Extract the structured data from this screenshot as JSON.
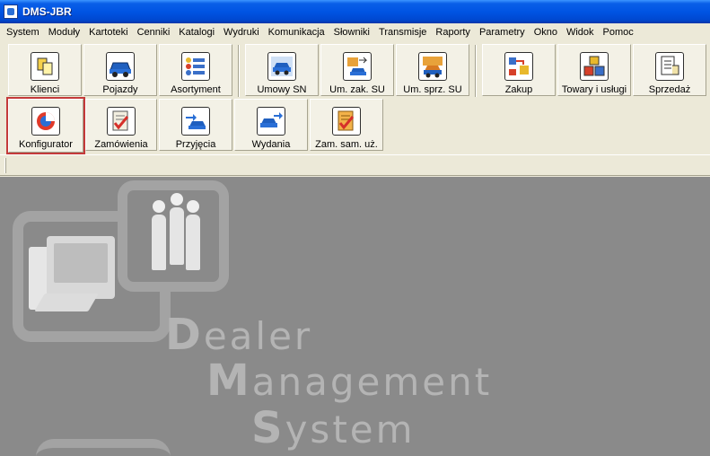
{
  "window": {
    "title": "DMS-JBR"
  },
  "menu": [
    "System",
    "Moduły",
    "Kartoteki",
    "Cenniki",
    "Katalogi",
    "Wydruki",
    "Komunikacja",
    "Słowniki",
    "Transmisje",
    "Raporty",
    "Parametry",
    "Okno",
    "Widok",
    "Pomoc"
  ],
  "toolbar": {
    "row1": [
      {
        "label": "Klienci",
        "icon": "clients-icon"
      },
      {
        "label": "Pojazdy",
        "icon": "car-icon"
      },
      {
        "label": "Asortyment",
        "icon": "list-icon"
      },
      {
        "label": "Umowy SN",
        "icon": "car-contract-icon"
      },
      {
        "label": "Um. zak. SU",
        "icon": "purchase-contract-icon"
      },
      {
        "label": "Um. sprz. SU",
        "icon": "sale-contract-icon"
      },
      {
        "label": "Zakup",
        "icon": "purchase-icon"
      },
      {
        "label": "Towary i usługi",
        "icon": "goods-icon"
      },
      {
        "label": "Sprzedaż",
        "icon": "sale-icon"
      }
    ],
    "row2": [
      {
        "label": "Konfigurator",
        "icon": "configurator-icon",
        "selected": true
      },
      {
        "label": "Zamówienia",
        "icon": "orders-icon"
      },
      {
        "label": "Przyjęcia",
        "icon": "receipts-icon"
      },
      {
        "label": "Wydania",
        "icon": "issues-icon"
      },
      {
        "label": "Zam. sam. uż.",
        "icon": "used-car-orders-icon"
      }
    ]
  },
  "logo": {
    "line1": {
      "cap": "D",
      "rest": "ealer"
    },
    "line2": {
      "cap": "M",
      "rest": "anagement"
    },
    "line3": {
      "cap": "S",
      "rest": "ystem"
    }
  },
  "colors": {
    "selected_outline": "#c43a3a",
    "titlebar": "#0054e3",
    "workspace": "#8a8a8a"
  }
}
